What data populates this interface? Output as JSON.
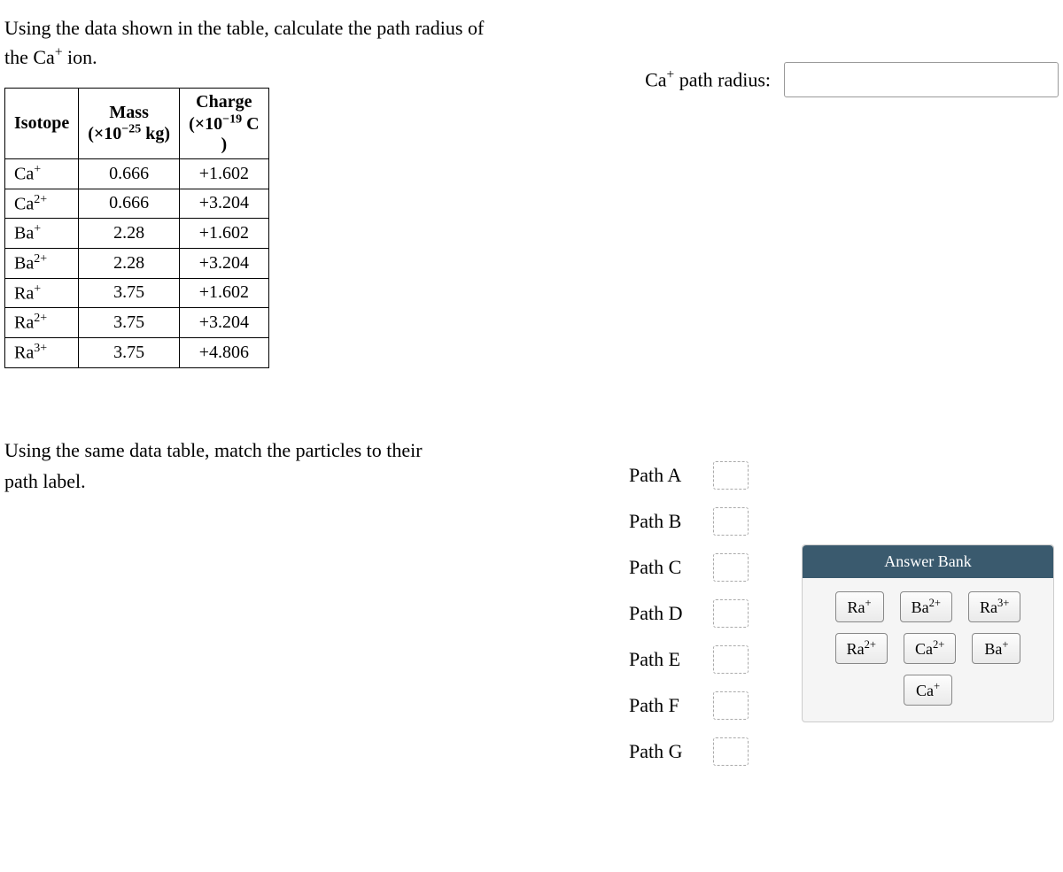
{
  "question1": {
    "line1": "Using the data shown in the table, calculate the path radius of",
    "line2": "the Ca⁺ ion."
  },
  "radius": {
    "label_prefix": "Ca",
    "label_sup": "+",
    "label_suffix": " path radius:",
    "value": ""
  },
  "table": {
    "headers": {
      "col1": "Isotope",
      "col2_line1": "Mass",
      "col2_line2_prefix": "(×10",
      "col2_line2_sup": "−25",
      "col2_line2_suffix": " kg)",
      "col3_line1": "Charge",
      "col3_line2_prefix": "(×10",
      "col3_line2_sup": "−19",
      "col3_line2_suffix": " C",
      "col3_line3": ")"
    },
    "rows": [
      {
        "iso_base": "Ca",
        "iso_sup": "+",
        "mass": "0.666",
        "charge": "+1.602"
      },
      {
        "iso_base": "Ca",
        "iso_sup": "2+",
        "mass": "0.666",
        "charge": "+3.204"
      },
      {
        "iso_base": "Ba",
        "iso_sup": "+",
        "mass": "2.28",
        "charge": "+1.602"
      },
      {
        "iso_base": "Ba",
        "iso_sup": "2+",
        "mass": "2.28",
        "charge": "+3.204"
      },
      {
        "iso_base": "Ra",
        "iso_sup": "+",
        "mass": "3.75",
        "charge": "+1.602"
      },
      {
        "iso_base": "Ra",
        "iso_sup": "2+",
        "mass": "3.75",
        "charge": "+3.204"
      },
      {
        "iso_base": "Ra",
        "iso_sup": "3+",
        "mass": "3.75",
        "charge": "+4.806"
      }
    ]
  },
  "question2": {
    "line1": "Using the same data table, match the particles to their",
    "line2": "path label."
  },
  "paths": [
    {
      "label": "Path A"
    },
    {
      "label": "Path B"
    },
    {
      "label": "Path C"
    },
    {
      "label": "Path D"
    },
    {
      "label": "Path E"
    },
    {
      "label": "Path F"
    },
    {
      "label": "Path G"
    }
  ],
  "answer_bank": {
    "title": "Answer Bank",
    "chips": [
      {
        "base": "Ra",
        "sup": "+"
      },
      {
        "base": "Ba",
        "sup": "2+"
      },
      {
        "base": "Ra",
        "sup": "3+"
      },
      {
        "base": "Ra",
        "sup": "2+"
      },
      {
        "base": "Ca",
        "sup": "2+"
      },
      {
        "base": "Ba",
        "sup": "+"
      },
      {
        "base": "Ca",
        "sup": "+"
      }
    ]
  }
}
